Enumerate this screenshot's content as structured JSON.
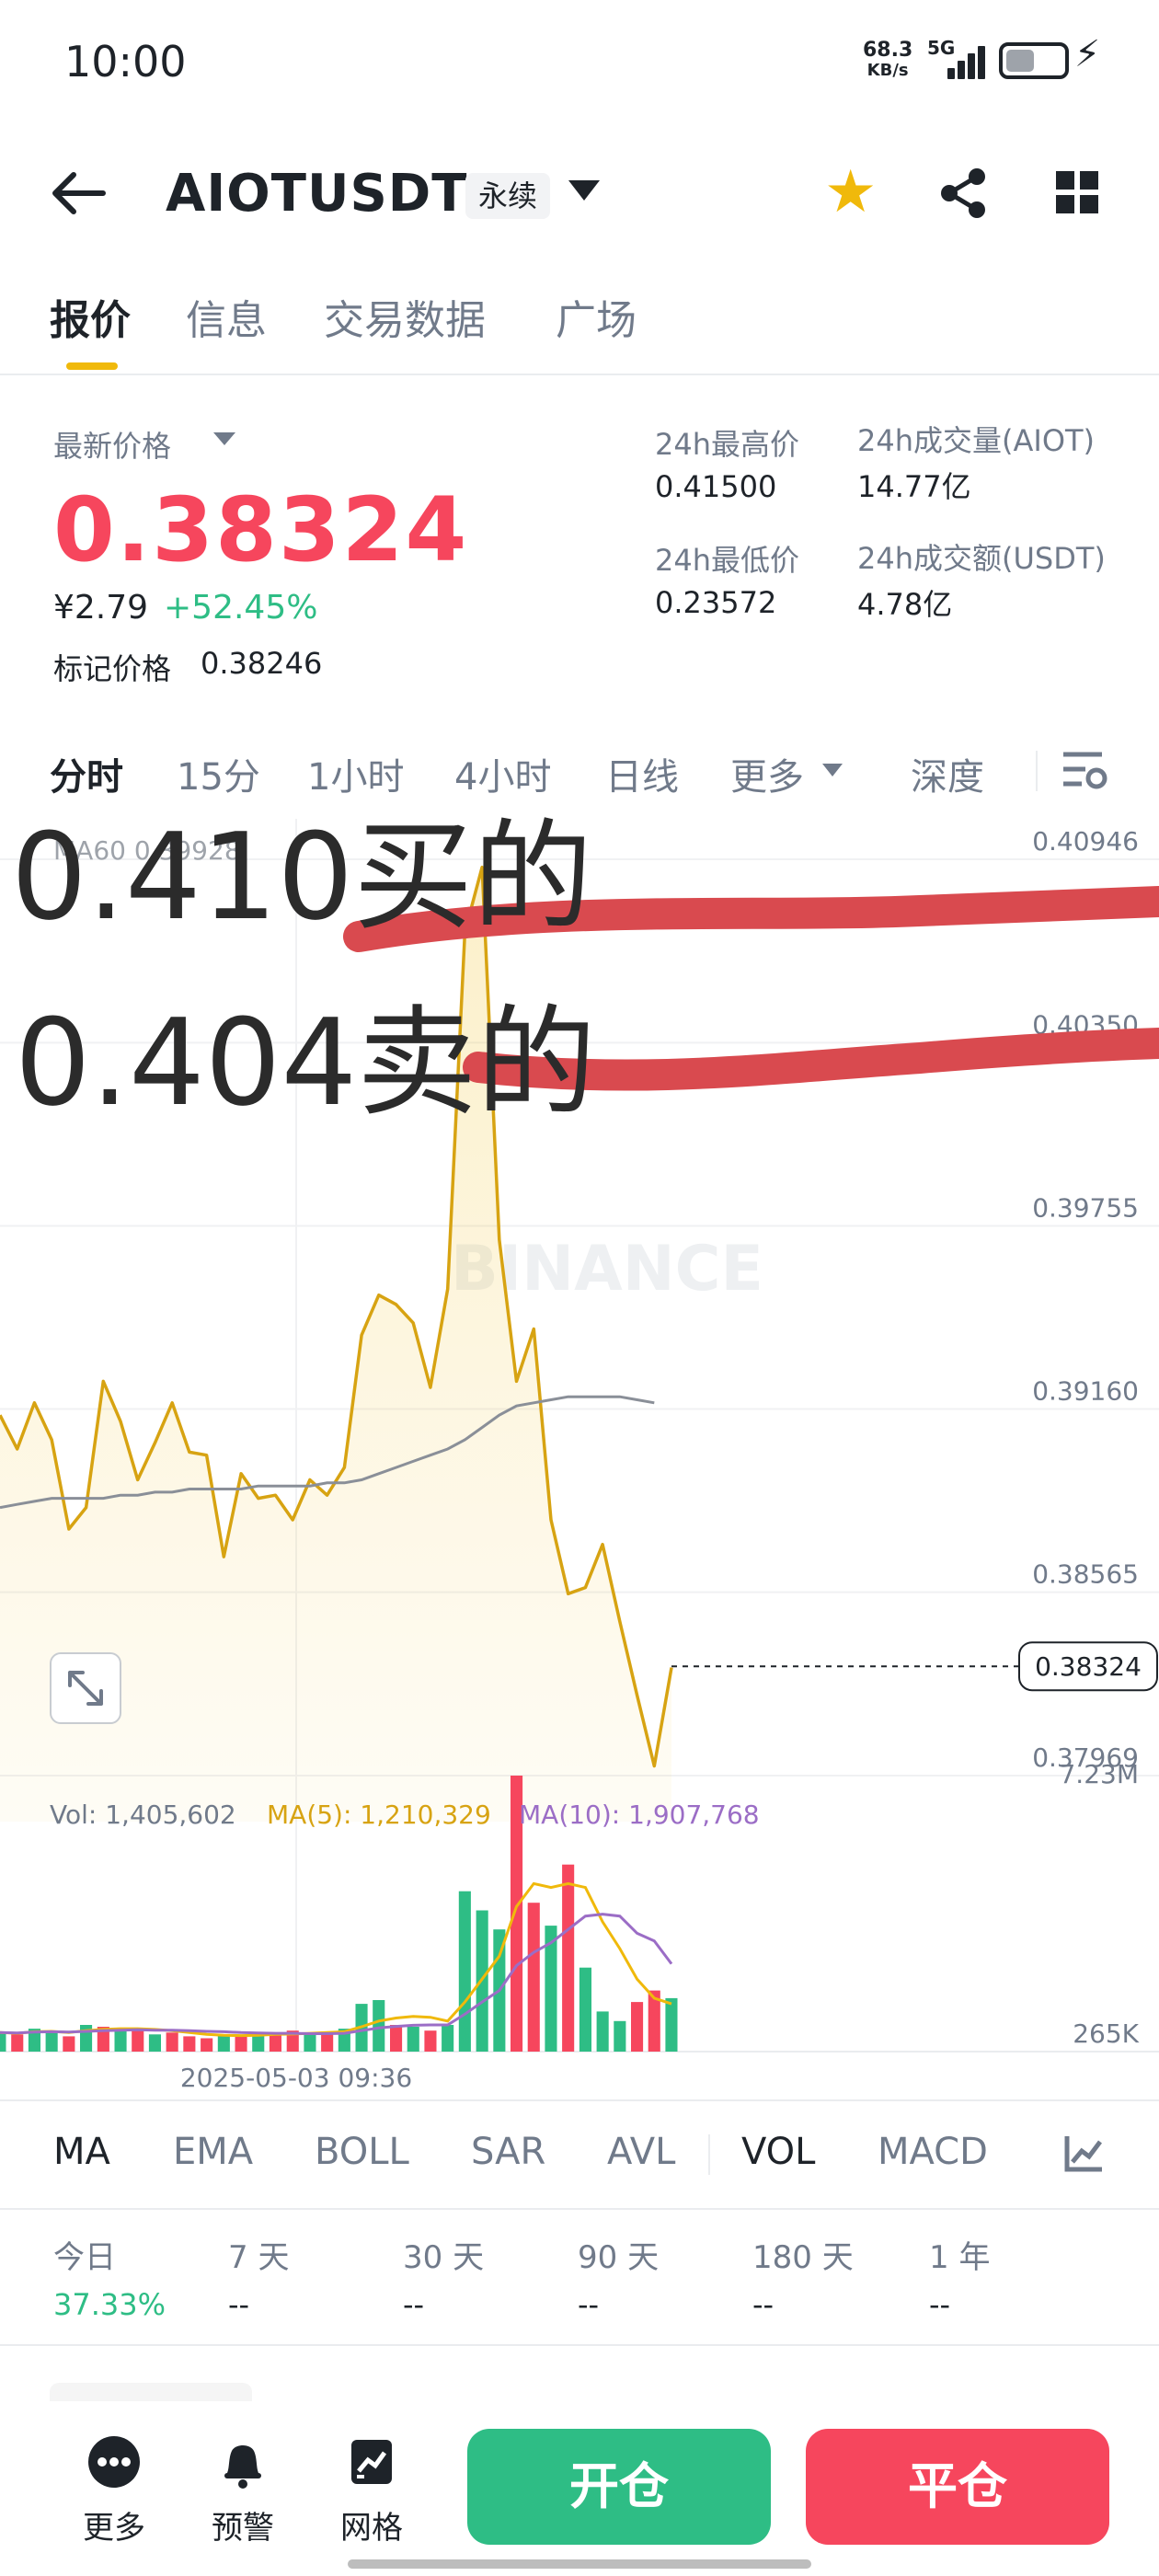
{
  "status_bar": {
    "time": "10:00",
    "net_speed_value": "68.3",
    "net_speed_unit": "KB/s",
    "network": "5G"
  },
  "header": {
    "symbol": "AIOTUSDT",
    "contract_tag": "永续",
    "icons": [
      "back-arrow-icon",
      "caret-down-icon",
      "star-icon",
      "share-icon",
      "grid-icon"
    ]
  },
  "tabs": [
    {
      "label": "报价",
      "active": true
    },
    {
      "label": "信息",
      "active": false
    },
    {
      "label": "交易数据",
      "active": false
    },
    {
      "label": "广场",
      "active": false
    }
  ],
  "price_panel": {
    "last_price_label": "最新价格",
    "last_price": "0.38324",
    "cny_price": "¥2.79",
    "change_pct": "+52.45%",
    "mark_price_label": "标记价格",
    "mark_price": "0.38246",
    "high_24h_label": "24h最高价",
    "high_24h": "0.41500",
    "low_24h_label": "24h最低价",
    "low_24h": "0.23572",
    "vol_base_label": "24h成交量(AIOT)",
    "vol_base": "14.77亿",
    "vol_quote_label": "24h成交额(USDT)",
    "vol_quote": "4.78亿"
  },
  "time_tabs": [
    {
      "label": "分时",
      "active": true
    },
    {
      "label": "15分",
      "active": false
    },
    {
      "label": "1小时",
      "active": false
    },
    {
      "label": "4小时",
      "active": false
    },
    {
      "label": "日线",
      "active": false
    },
    {
      "label": "更多",
      "active": false
    },
    {
      "label": "深度",
      "active": false
    }
  ],
  "chart_data": {
    "type": "line",
    "title": "",
    "watermark": "BINANCE",
    "ma_legend": "MA60 0.39928",
    "y_ticks": [
      "0.40946",
      "0.40350",
      "0.39755",
      "0.39160",
      "0.38565",
      "0.37969"
    ],
    "ylim": [
      0.37969,
      0.40946
    ],
    "current_price_label": "0.38324",
    "x_tick_label": "2025-05-03 09:36",
    "series": [
      {
        "key": "price",
        "color": "#d7a312",
        "values": [
          0.3914,
          0.3903,
          0.3918,
          0.3906,
          0.3877,
          0.3884,
          0.3925,
          0.3912,
          0.3893,
          0.3905,
          0.3918,
          0.3902,
          0.3901,
          0.3868,
          0.3895,
          0.3887,
          0.3888,
          0.388,
          0.3893,
          0.3888,
          0.3897,
          0.394,
          0.3953,
          0.395,
          0.3944,
          0.3923,
          0.3955,
          0.4071,
          0.4092,
          0.3971,
          0.3925,
          0.3942,
          0.388,
          0.3856,
          0.3858,
          0.3872,
          0.3847,
          0.3823,
          0.38,
          0.3832
        ]
      },
      {
        "key": "ma60",
        "color": "#8a8f98",
        "values": [
          0.3884,
          0.3885,
          0.3886,
          0.3887,
          0.3887,
          0.3887,
          0.3887,
          0.3888,
          0.3888,
          0.3889,
          0.3889,
          0.389,
          0.389,
          0.389,
          0.389,
          0.3891,
          0.3891,
          0.3891,
          0.3891,
          0.3892,
          0.3892,
          0.3893,
          0.3895,
          0.3897,
          0.3899,
          0.3901,
          0.3903,
          0.3906,
          0.391,
          0.3914,
          0.3917,
          0.3918,
          0.3919,
          0.392,
          0.392,
          0.392,
          0.392,
          0.3919,
          0.3918
        ]
      }
    ],
    "volume": {
      "vol_label": "Vol: 1,405,602",
      "ma5_label": "MA(5): 1,210,329",
      "ma10_label": "MA(10): 1,907,768",
      "y_ticks": [
        "7.23M",
        "265K"
      ],
      "ylim": [
        0,
        7.23
      ],
      "unit": "M",
      "bars": [
        {
          "v": 0.5,
          "up": true
        },
        {
          "v": 0.45,
          "up": false
        },
        {
          "v": 0.6,
          "up": true
        },
        {
          "v": 0.55,
          "up": true
        },
        {
          "v": 0.4,
          "up": false
        },
        {
          "v": 0.7,
          "up": true
        },
        {
          "v": 0.65,
          "up": false
        },
        {
          "v": 0.6,
          "up": true
        },
        {
          "v": 0.55,
          "up": false
        },
        {
          "v": 0.45,
          "up": true
        },
        {
          "v": 0.5,
          "up": false
        },
        {
          "v": 0.4,
          "up": false
        },
        {
          "v": 0.35,
          "up": false
        },
        {
          "v": 0.45,
          "up": true
        },
        {
          "v": 0.4,
          "up": false
        },
        {
          "v": 0.5,
          "up": true
        },
        {
          "v": 0.45,
          "up": false
        },
        {
          "v": 0.55,
          "up": false
        },
        {
          "v": 0.5,
          "up": true
        },
        {
          "v": 0.45,
          "up": false
        },
        {
          "v": 0.6,
          "up": true
        },
        {
          "v": 1.25,
          "up": true
        },
        {
          "v": 1.35,
          "up": true
        },
        {
          "v": 0.7,
          "up": false
        },
        {
          "v": 0.65,
          "up": true
        },
        {
          "v": 0.55,
          "up": false
        },
        {
          "v": 0.7,
          "up": true
        },
        {
          "v": 4.2,
          "up": true
        },
        {
          "v": 3.7,
          "up": true
        },
        {
          "v": 3.2,
          "up": true
        },
        {
          "v": 7.23,
          "up": false
        },
        {
          "v": 3.9,
          "up": false
        },
        {
          "v": 3.3,
          "up": true
        },
        {
          "v": 4.9,
          "up": false
        },
        {
          "v": 2.2,
          "up": true
        },
        {
          "v": 1.05,
          "up": true
        },
        {
          "v": 0.8,
          "up": true
        },
        {
          "v": 1.3,
          "up": false
        },
        {
          "v": 1.6,
          "up": false
        },
        {
          "v": 1.4,
          "up": true
        }
      ],
      "ma5": [
        0.5,
        0.48,
        0.52,
        0.53,
        0.5,
        0.55,
        0.58,
        0.6,
        0.6,
        0.58,
        0.55,
        0.5,
        0.45,
        0.43,
        0.42,
        0.43,
        0.45,
        0.46,
        0.48,
        0.5,
        0.52,
        0.65,
        0.8,
        0.88,
        0.92,
        0.9,
        0.8,
        1.3,
        1.9,
        2.5,
        3.8,
        4.4,
        4.3,
        4.4,
        4.3,
        3.4,
        2.7,
        1.9,
        1.4,
        1.25
      ],
      "ma10": [
        0.5,
        0.49,
        0.51,
        0.52,
        0.51,
        0.53,
        0.55,
        0.56,
        0.57,
        0.56,
        0.56,
        0.55,
        0.53,
        0.52,
        0.5,
        0.49,
        0.48,
        0.48,
        0.47,
        0.47,
        0.48,
        0.55,
        0.62,
        0.66,
        0.69,
        0.7,
        0.7,
        0.98,
        1.3,
        1.6,
        2.25,
        2.6,
        2.85,
        3.2,
        3.55,
        3.6,
        3.55,
        3.1,
        2.9,
        2.3
      ]
    }
  },
  "annotations": {
    "buy_note": "0.410买的",
    "sell_note": "0.404卖的"
  },
  "indicator_bar": [
    {
      "label": "MA",
      "active": true
    },
    {
      "label": "EMA",
      "active": false
    },
    {
      "label": "BOLL",
      "active": false
    },
    {
      "label": "SAR",
      "active": false
    },
    {
      "label": "AVL",
      "active": false
    },
    {
      "label": "VOL",
      "active": true
    },
    {
      "label": "MACD",
      "active": false
    }
  ],
  "period_stats": [
    {
      "label": "今日",
      "value": "37.33%",
      "positive": true
    },
    {
      "label": "7 天",
      "value": "--",
      "positive": false
    },
    {
      "label": "30 天",
      "value": "--",
      "positive": false
    },
    {
      "label": "90 天",
      "value": "--",
      "positive": false
    },
    {
      "label": "180 天",
      "value": "--",
      "positive": false
    },
    {
      "label": "1 年",
      "value": "--",
      "positive": false
    }
  ],
  "bottom_bar": {
    "more_label": "更多",
    "alert_label": "预警",
    "grid_label": "网格",
    "open_label": "开仓",
    "close_label": "平仓"
  },
  "colors": {
    "up": "#2ebd85",
    "down": "#f6465d",
    "accent": "#f0b90b",
    "ma5": "#f0b90b",
    "ma10": "#9b6dc6",
    "annotation_stroke": "#d94a4f"
  }
}
